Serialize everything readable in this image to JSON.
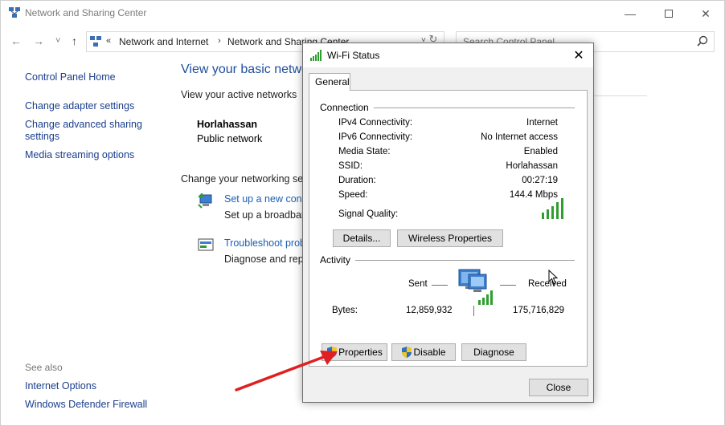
{
  "window": {
    "title": "Network and Sharing Center",
    "controls": {
      "minimize": "—",
      "maximize": "□",
      "close": "✕"
    }
  },
  "nav": {
    "back": "←",
    "forward": "→",
    "recent": "˅",
    "up": "↑",
    "breadcrumb_sep": "«",
    "crumbs": [
      "Network and Internet",
      "Network and Sharing Center"
    ],
    "crumb_arrow": "›",
    "dropdown": "˅",
    "refresh": "↻",
    "search_placeholder": "Search Control Panel"
  },
  "sidebar": {
    "home": "Control Panel Home",
    "items": [
      "Change adapter settings",
      "Change advanced sharing settings",
      "Media streaming options"
    ],
    "see_also_label": "See also",
    "see_also": [
      "Internet Options",
      "Windows Defender Firewall"
    ]
  },
  "main": {
    "title": "View your basic netwo",
    "active_networks_label": "View your active networks",
    "network_name": "Horlahassan",
    "network_type": "Public network",
    "change_settings_label": "Change your networking setti",
    "tasks": [
      {
        "link": "Set up a new conn",
        "desc": "Set up a broadband",
        "icon": "network-setup-icon"
      },
      {
        "link": "Troubleshoot probl",
        "desc": "Diagnose and repa",
        "icon": "troubleshoot-icon"
      }
    ]
  },
  "dialog": {
    "title": "Wi-Fi Status",
    "close": "✕",
    "tab": "General",
    "connection_label": "Connection",
    "rows": [
      {
        "label": "IPv4 Connectivity:",
        "value": "Internet"
      },
      {
        "label": "IPv6 Connectivity:",
        "value": "No Internet access"
      },
      {
        "label": "Media State:",
        "value": "Enabled"
      },
      {
        "label": "SSID:",
        "value": "Horlahassan"
      },
      {
        "label": "Duration:",
        "value": "00:27:19"
      },
      {
        "label": "Speed:",
        "value": "144.4 Mbps"
      }
    ],
    "signal_quality_label": "Signal Quality:",
    "signal_level": "5/5",
    "details_button": "Details...",
    "wireless_properties_button": "Wireless Properties",
    "activity_label": "Activity",
    "sent_label": "Sent",
    "received_label": "Received",
    "bytes_label": "Bytes:",
    "bytes_sent": "12,859,932",
    "bytes_received": "175,716,829",
    "properties_button": "Properties",
    "disable_button": "Disable",
    "diagnose_button": "Diagnose",
    "close_button": "Close"
  },
  "colors": {
    "link": "#1a3e8c",
    "title_blue": "#1f4e9a",
    "annotation_arrow": "#e02020",
    "signal_green": "#2e9e2e"
  }
}
